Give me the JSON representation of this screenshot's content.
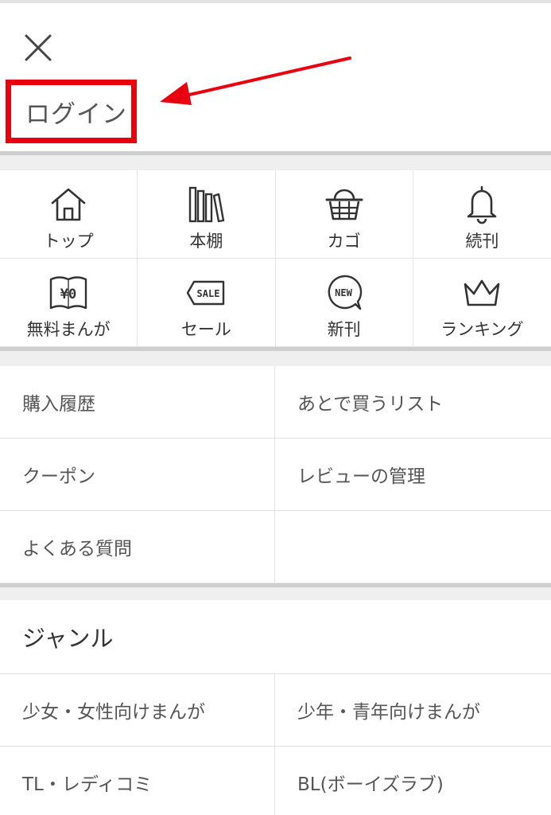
{
  "header": {
    "login_label": "ログイン",
    "close_icon": "close-icon",
    "annotation_color": "#e8000e"
  },
  "icon_grid": {
    "items": [
      {
        "label": "トップ",
        "icon": "home-icon"
      },
      {
        "label": "本棚",
        "icon": "bookshelf-icon"
      },
      {
        "label": "カゴ",
        "icon": "basket-icon"
      },
      {
        "label": "続刊",
        "icon": "bell-icon"
      },
      {
        "label": "無料まんが",
        "icon": "free-book-icon",
        "icon_text": "¥0"
      },
      {
        "label": "セール",
        "icon": "sale-tag-icon",
        "icon_text": "SALE"
      },
      {
        "label": "新刊",
        "icon": "new-badge-icon",
        "icon_text": "NEW"
      },
      {
        "label": "ランキング",
        "icon": "crown-icon"
      }
    ]
  },
  "account_links": {
    "items": [
      {
        "label": "購入履歴"
      },
      {
        "label": "あとで買うリスト"
      },
      {
        "label": "クーポン"
      },
      {
        "label": "レビューの管理"
      },
      {
        "label": "よくある質問"
      }
    ]
  },
  "genre": {
    "title": "ジャンル",
    "items": [
      {
        "label": "少女・女性向けまんが"
      },
      {
        "label": "少年・青年向けまんが"
      },
      {
        "label": "TL・レディコミ"
      },
      {
        "label": "BL(ボーイズラブ)"
      }
    ]
  }
}
